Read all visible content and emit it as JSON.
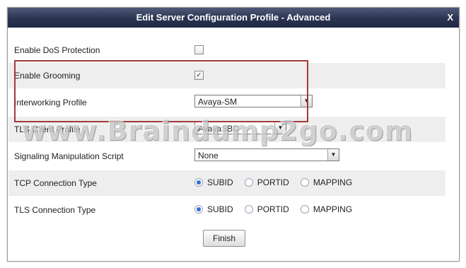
{
  "dialog": {
    "title": "Edit Server Configuration Profile - Advanced",
    "close_label": "X"
  },
  "rows": {
    "dos": {
      "label": "Enable DoS Protection",
      "checked": false
    },
    "grooming": {
      "label": "Enable Grooming",
      "checked": true,
      "check_glyph": "✓"
    },
    "interworking": {
      "label": "Interworking Profile",
      "value": "Avaya-SM"
    },
    "tls_client": {
      "label": "TLS Client Profile",
      "value": "AvayaSBC"
    },
    "sigman": {
      "label": "Signaling Manipulation Script",
      "value": "None"
    },
    "tcp": {
      "label": "TCP Connection Type",
      "options": [
        "SUBID",
        "PORTID",
        "MAPPING"
      ],
      "selected": "SUBID"
    },
    "tls": {
      "label": "TLS Connection Type",
      "options": [
        "SUBID",
        "PORTID",
        "MAPPING"
      ],
      "selected": "SUBID"
    }
  },
  "buttons": {
    "finish": "Finish"
  },
  "watermark": "www.Braindump2go.com",
  "colors": {
    "title_bar": "#2a3452",
    "highlight_border": "#a03a3a",
    "radio_selected": "#2f6fd6",
    "row_shade": "#eeeeee"
  }
}
